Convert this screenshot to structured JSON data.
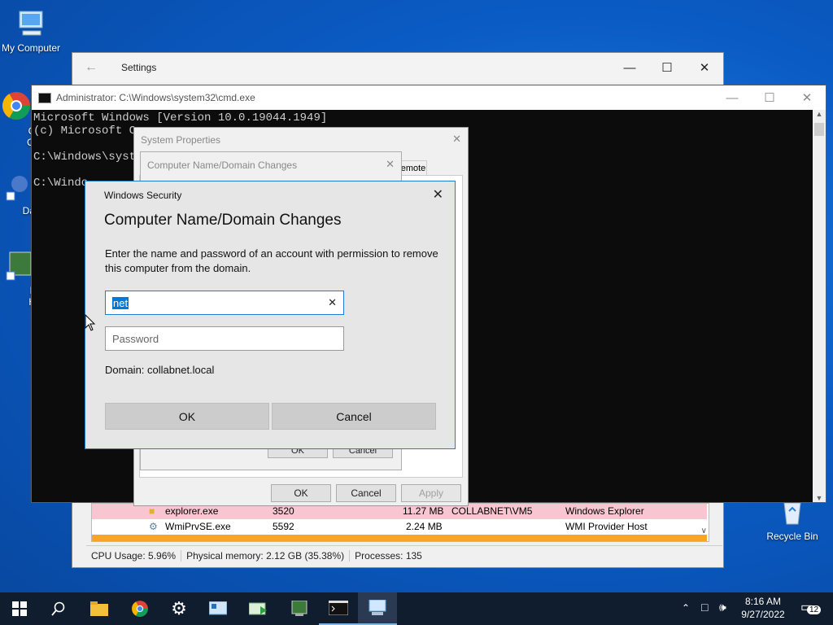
{
  "desktop": {
    "icons": [
      {
        "label": "My Computer"
      },
      {
        "label1": "Goo",
        "label2": "Chro"
      },
      {
        "label1": "DataW"
      },
      {
        "label1": "Pro",
        "label2": "Hac"
      },
      {
        "label": "Recycle Bin"
      }
    ]
  },
  "settings": {
    "title": "Settings"
  },
  "cmd": {
    "title": "Administrator: C:\\Windows\\system32\\cmd.exe",
    "lines": [
      "Microsoft Windows [Version 10.0.19044.1949]",
      "(c) Microsoft Co",
      "",
      "C:\\Windows\\syste",
      "",
      "C:\\Windo"
    ]
  },
  "system_properties": {
    "title": "System Properties",
    "tab_remote": "emote",
    "ok": "OK",
    "cancel": "Cancel",
    "apply": "Apply"
  },
  "computer_name_dialog": {
    "title": "Computer Name/Domain Changes",
    "ok": "OK",
    "cancel": "Cancel"
  },
  "windows_security": {
    "header": "Windows Security",
    "title": "Computer Name/Domain Changes",
    "description": "Enter the name and password of an account with permission to remove this computer from the domain.",
    "username_value": "net",
    "password_placeholder": "Password",
    "domain_label": "Domain: collabnet.local",
    "ok": "OK",
    "cancel": "Cancel"
  },
  "task_manager": {
    "rows": [
      {
        "name": "explorer.exe",
        "pid": "3520",
        "memory": "11.27 MB",
        "user": "COLLABNET\\VM5",
        "description": "Windows Explorer",
        "color": "#f7c6d0"
      },
      {
        "name": "WmiPrvSE.exe",
        "pid": "5592",
        "memory": "2.24 MB",
        "user": "",
        "description": "WMI Provider Host",
        "color": "#ffffff"
      }
    ],
    "status": {
      "cpu": "CPU Usage: 5.96%",
      "memory": "Physical memory: 2.12 GB (35.38%)",
      "processes": "Processes: 135"
    }
  },
  "taskbar": {
    "time": "8:16 AM",
    "date": "9/27/2022",
    "notification_count": "12"
  },
  "colors": {
    "accent": "#1a7dd6",
    "selection": "#0078d7",
    "taskbar": "#0f1d2e",
    "highlight_row_orange": "#f5a623"
  }
}
